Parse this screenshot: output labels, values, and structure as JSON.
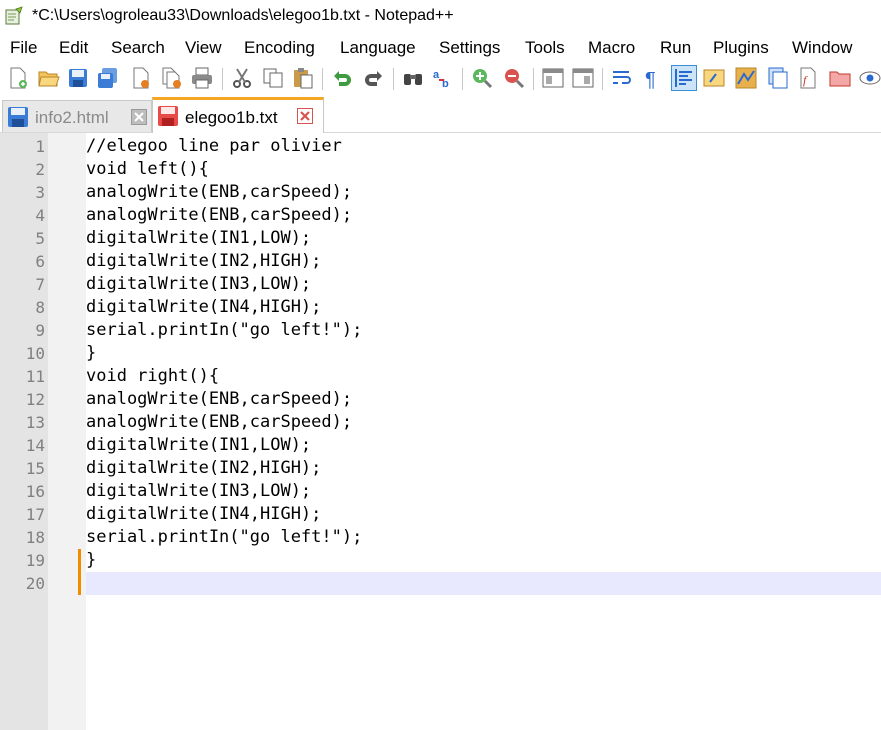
{
  "window": {
    "title": "*C:\\Users\\ogroleau33\\Downloads\\elegoo1b.txt - Notepad++"
  },
  "menu": [
    "File",
    "Edit",
    "Search",
    "View",
    "Encoding",
    "Language",
    "Settings",
    "Tools",
    "Macro",
    "Run",
    "Plugins",
    "Window"
  ],
  "toolbar": {
    "icons": [
      "new-file-icon",
      "open-file-icon",
      "save-icon",
      "save-all-icon",
      "close-icon",
      "close-all-icon",
      "print-icon",
      "cut-icon",
      "copy-icon",
      "paste-icon",
      "undo-icon",
      "redo-icon",
      "find-icon",
      "replace-icon",
      "zoom-in-icon",
      "zoom-out-icon",
      "sync-vertical-icon",
      "sync-horizontal-icon",
      "word-wrap-icon",
      "show-all-chars-icon",
      "indent-guide-icon",
      "user-language-icon",
      "doc-map-icon",
      "doc-list-icon",
      "function-list-icon",
      "folder-workspace-icon",
      "monitoring-icon"
    ]
  },
  "tabs": [
    {
      "label": "info2.html",
      "active": false,
      "saved": true
    },
    {
      "label": "elegoo1b.txt",
      "active": true,
      "saved": false
    }
  ],
  "editor": {
    "lines": [
      "//elegoo line par olivier",
      "void left(){",
      "analogWrite(ENB,carSpeed);",
      "analogWrite(ENB,carSpeed);",
      "digitalWrite(IN1,LOW);",
      "digitalWrite(IN2,HIGH);",
      "digitalWrite(IN3,LOW);",
      "digitalWrite(IN4,HIGH);",
      "serial.printIn(\"go left!\");",
      "}",
      "void right(){",
      "analogWrite(ENB,carSpeed);",
      "analogWrite(ENB,carSpeed);",
      "digitalWrite(IN1,LOW);",
      "digitalWrite(IN2,HIGH);",
      "digitalWrite(IN3,LOW);",
      "digitalWrite(IN4,HIGH);",
      "serial.printIn(\"go left!\");",
      "}",
      ""
    ],
    "line_numbers": [
      "1",
      "2",
      "3",
      "4",
      "5",
      "6",
      "7",
      "8",
      "9",
      "10",
      "11",
      "12",
      "13",
      "14",
      "15",
      "16",
      "17",
      "18",
      "19",
      "20"
    ],
    "current_line": 20,
    "modified_lines": [
      19,
      20
    ]
  },
  "colors": {
    "accent": "#f5a623",
    "change_marker": "#f08c00",
    "current_line_bg": "#e8e8ff"
  }
}
